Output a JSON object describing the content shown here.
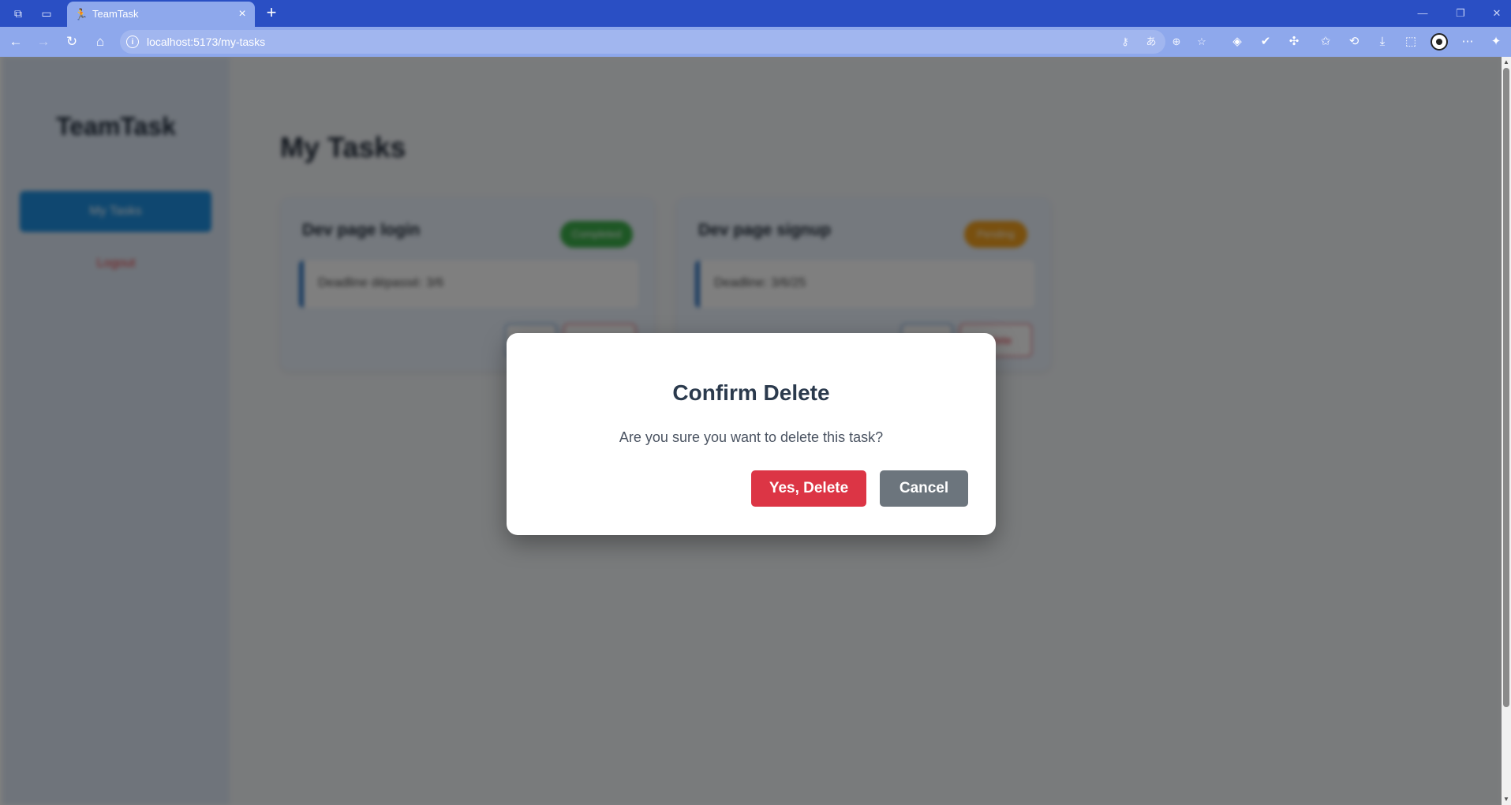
{
  "browser": {
    "tab_title": "TeamTask",
    "url": "localhost:5173/my-tasks"
  },
  "sidebar": {
    "brand": "TeamTask",
    "nav_label": "My Tasks",
    "logout_label": "Logout"
  },
  "main": {
    "title": "My Tasks",
    "tasks": [
      {
        "title": "Dev page login",
        "status": "Completed",
        "deadline": "Deadline dépassé: 3/6",
        "edit_label": "Edit",
        "delete_label": "Delete",
        "status_color": "#3cae4a"
      },
      {
        "title": "Dev page signup",
        "status": "Pending",
        "deadline": "Deadline: 3/6/25",
        "edit_label": "Edit",
        "delete_label": "Delete",
        "status_color": "#f2a01e"
      }
    ]
  },
  "modal": {
    "title": "Confirm Delete",
    "message": "Are you sure you want to delete this task?",
    "confirm_label": "Yes, Delete",
    "cancel_label": "Cancel"
  },
  "colors": {
    "danger": "#dc3545",
    "secondary": "#6c757d",
    "primary": "#1e8fe0",
    "chrome": "#2a4fc4"
  }
}
